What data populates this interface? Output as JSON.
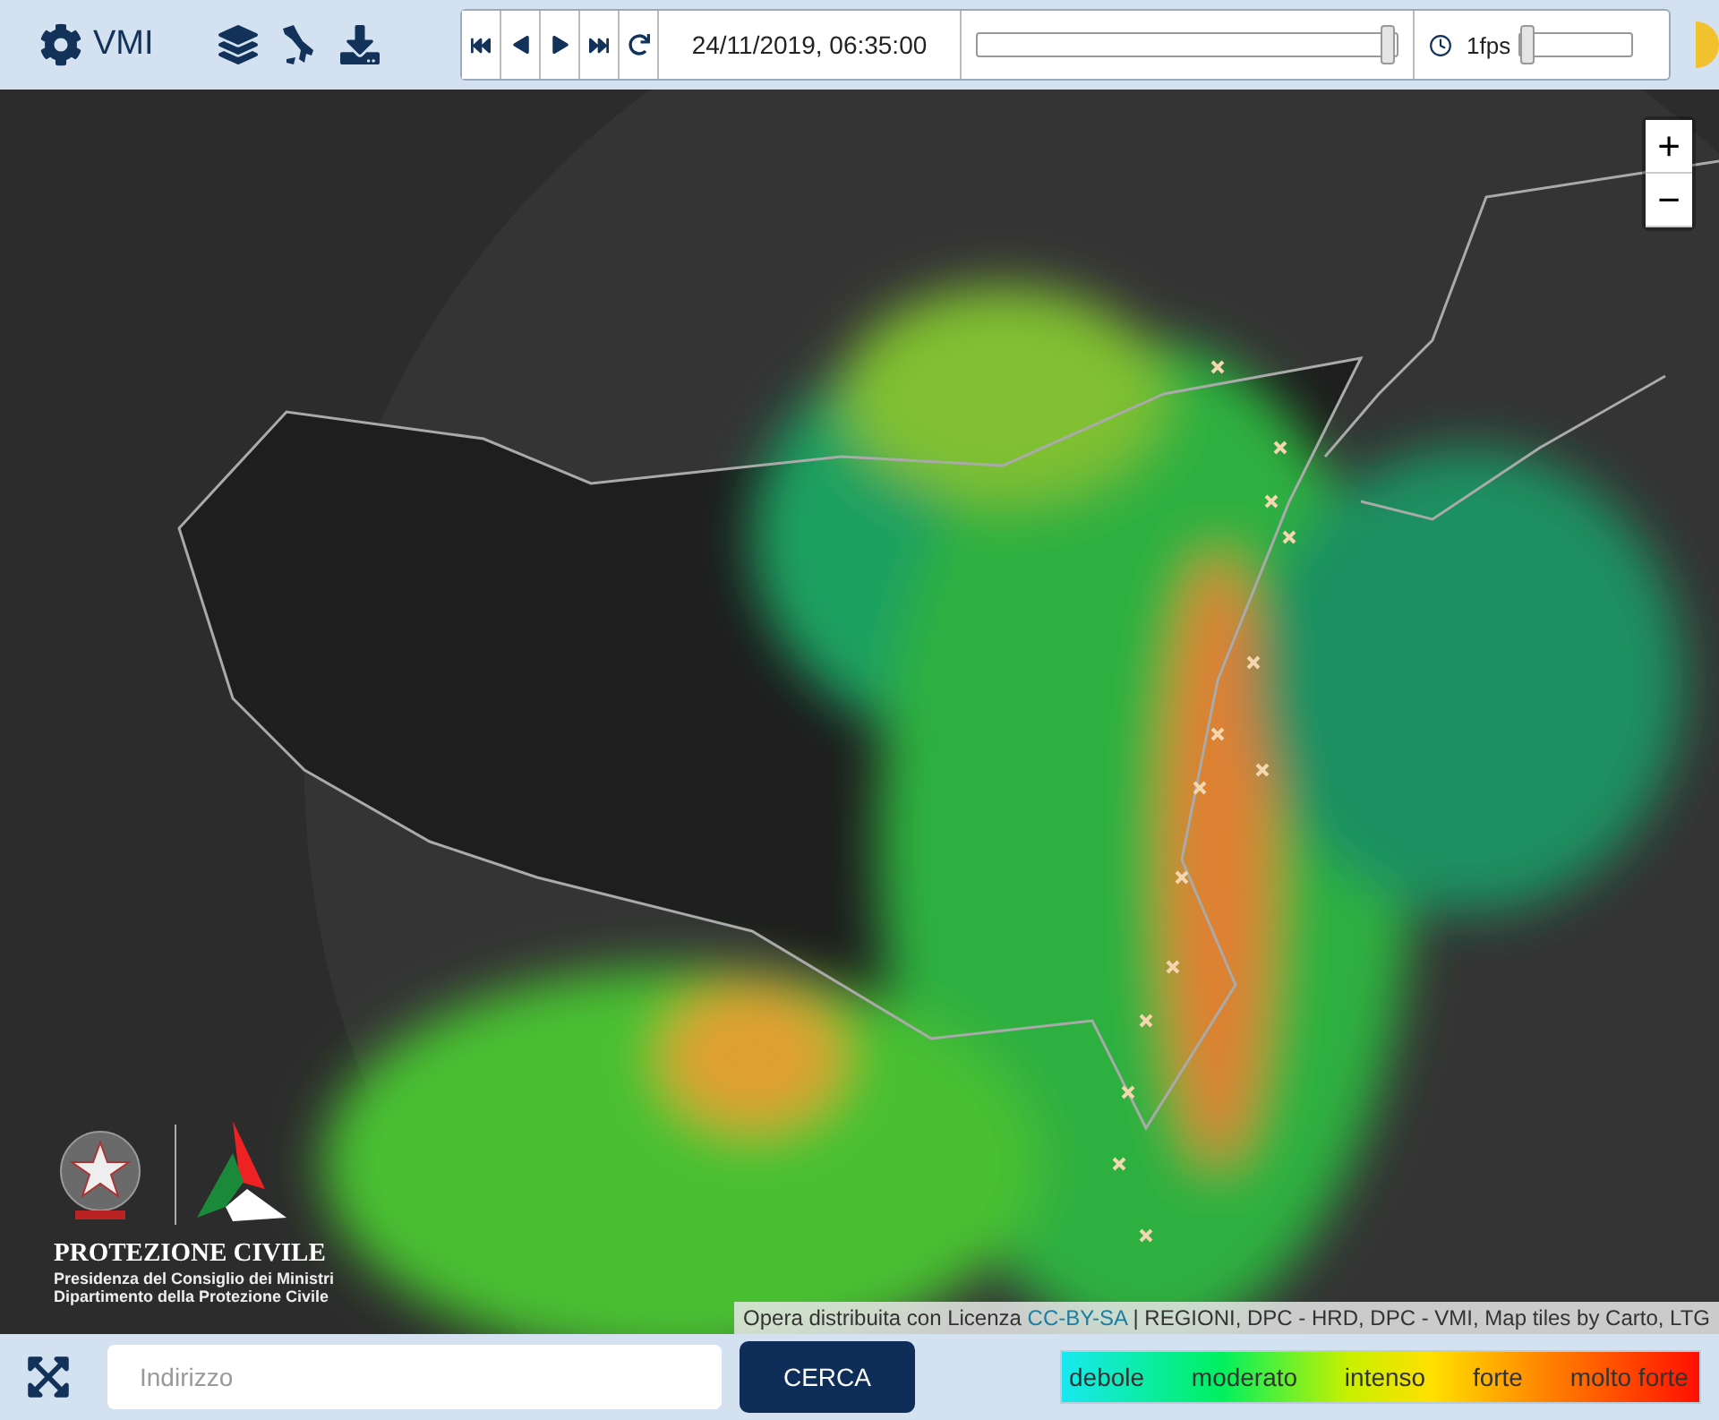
{
  "header": {
    "title": "VMI"
  },
  "player": {
    "timestamp": "24/11/2019, 06:35:00",
    "time_slider": {
      "level": 0.99
    },
    "speed": {
      "reading": "1fps",
      "level": 0.03
    }
  },
  "zoom": {
    "zoom_in": "+",
    "zoom_out": "−"
  },
  "logo": {
    "name": "PROTEZIONE CIVILE",
    "line_1": "Presidenza del Consiglio dei Ministri",
    "line_2": "Dipartimento della Protezione Civile"
  },
  "attribution": {
    "prefix": "Opera distribuita con Licenza ",
    "link": "CC-BY-SA",
    "suffix": " | REGIONI, DPC - HRD, DPC - VMI, Map tiles by Carto, LTG"
  },
  "search": {
    "placeholder": "Indirizzo",
    "button": "CERCA"
  },
  "legend": [
    "debole",
    "moderato",
    "intenso",
    "forte",
    "molto forte"
  ]
}
